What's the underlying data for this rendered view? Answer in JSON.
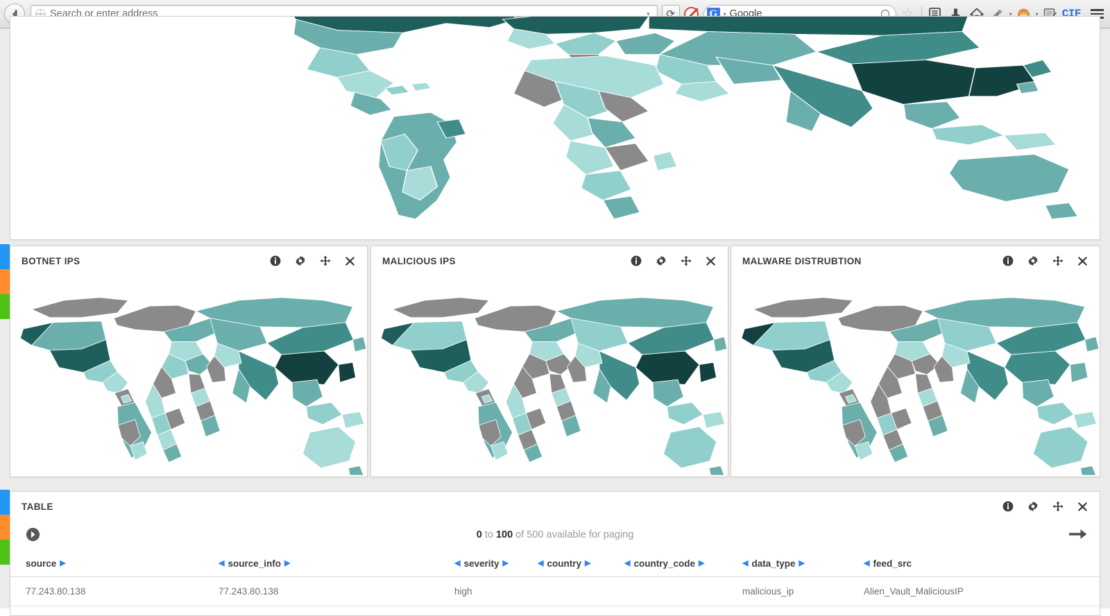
{
  "browser": {
    "back_label": "Back",
    "address_placeholder": "Search or enter address",
    "address_value": "",
    "reload_glyph": "⟳",
    "noscript_label": "NoScript",
    "search_engine": "Google",
    "search_value": "",
    "search_g_letter": "G",
    "bookmark_label": "Bookmark this page",
    "library_label": "Show your library",
    "downloads_label": "Downloads",
    "home_label": "Home",
    "plug_label": "Plugins",
    "monkey_label": "Greasemonkey",
    "notes_label": "Notes",
    "cif_label": "CIF",
    "menu_label": "Open menu",
    "caret_glyph": "▾"
  },
  "edge_strip": {
    "colors": [
      "#2196f3",
      "#ff8b2b",
      "#4fc21a"
    ]
  },
  "map_palette": {
    "nodata": "#8a8a8a",
    "l1": "#a8dcd9",
    "l2": "#90cfcb",
    "l3": "#6aafac",
    "l4": "#3f8c88",
    "l5": "#1e5f5b",
    "l6": "#12413f",
    "ocean": "#ffffff",
    "border": "#ffffff"
  },
  "panels": [
    {
      "id": "overview",
      "title": "",
      "tools": []
    },
    {
      "id": "botnet-ips",
      "title": "BOTNET IPS",
      "tools": [
        "info-icon",
        "gear-icon",
        "move-icon",
        "close-icon"
      ]
    },
    {
      "id": "malicious-ips",
      "title": "MALICIOUS IPS",
      "tools": [
        "info-icon",
        "gear-icon",
        "move-icon",
        "close-icon"
      ]
    },
    {
      "id": "malware-distrubtion",
      "title": "MALWARE DISTRUBTION",
      "tools": [
        "info-icon",
        "gear-icon",
        "move-icon",
        "close-icon"
      ]
    }
  ],
  "table_panel": {
    "title": "TABLE",
    "tools": [
      "info-icon",
      "gear-icon",
      "move-icon",
      "close-icon"
    ],
    "paging": {
      "prev_icon": "prev-page-icon",
      "next_icon": "next-page-icon",
      "from": "0",
      "to_label": "to",
      "to": "100",
      "of_label": "of",
      "total": "500",
      "suffix": "available for paging"
    },
    "columns": [
      {
        "key": "source",
        "label": "source",
        "left_arrow": false,
        "right_arrow": true
      },
      {
        "key": "source_info",
        "label": "source_info",
        "left_arrow": true,
        "right_arrow": true
      },
      {
        "key": "severity",
        "label": "severity",
        "left_arrow": true,
        "right_arrow": true
      },
      {
        "key": "country",
        "label": "country",
        "left_arrow": true,
        "right_arrow": true
      },
      {
        "key": "country_code",
        "label": "country_code",
        "left_arrow": true,
        "right_arrow": true
      },
      {
        "key": "data_type",
        "label": "data_type",
        "left_arrow": true,
        "right_arrow": true
      },
      {
        "key": "feed_src",
        "label": "feed_src",
        "left_arrow": true,
        "right_arrow": false
      }
    ],
    "rows": [
      {
        "source": "77.243.80.138",
        "source_info": "77.243.80.138",
        "severity": "high",
        "country": "",
        "country_code": "",
        "data_type": "malicious_ip",
        "feed_src": "Alien_Vault_MaliciousIP"
      }
    ]
  }
}
